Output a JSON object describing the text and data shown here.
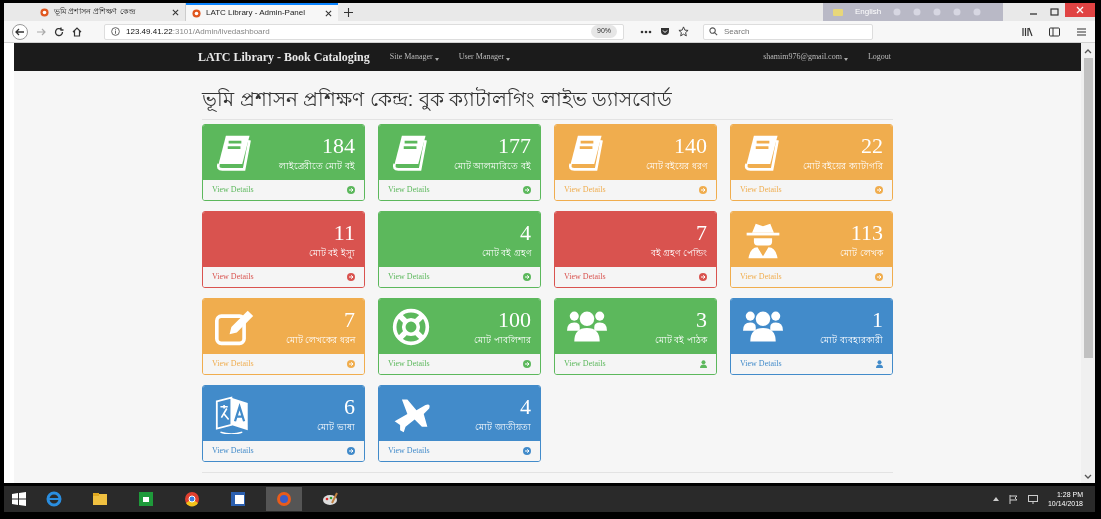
{
  "browser": {
    "tabs": [
      {
        "title": "ভূমি প্রশাসন প্রশিক্ষণ কেন্দ্র",
        "selected": false
      },
      {
        "title": "LATC Library - Admin-Panel",
        "selected": true
      }
    ],
    "url": {
      "host": "123.49.41.22",
      "path": ":3101/Admin/livedashboard"
    },
    "zoom": "90%",
    "search_placeholder": "Search",
    "language": "English"
  },
  "navbar": {
    "brand": "LATC Library - Book Cataloging",
    "menus": [
      {
        "label": "Site Manager",
        "dropdown": true
      },
      {
        "label": "User Manager",
        "dropdown": true
      }
    ],
    "user": {
      "label": "shamim976@gmail.com",
      "dropdown": true
    },
    "logout": "Logout"
  },
  "heading": "ভূমি প্রশাসন প্রশিক্ষণ কেন্দ্র: বুক ক্যাটালগিং লাইভ ড্যাসবোর্ড",
  "cards": [
    {
      "value": "184",
      "label": "লাইব্রেরীতে মোট বই",
      "color": "#5cb85c",
      "kind": "book",
      "footer": {
        "link": "View Details",
        "kind": "arrow"
      }
    },
    {
      "value": "177",
      "label": "মোট আলমারিতে বই",
      "color": "#5cb85c",
      "kind": "book",
      "footer": {
        "link": "View Details",
        "kind": "arrow"
      }
    },
    {
      "value": "140",
      "label": "মোট বইয়ের ধরণ",
      "color": "#f0ad4e",
      "kind": "book",
      "footer": {
        "link": "View Details",
        "kind": "arrow"
      }
    },
    {
      "value": "22",
      "label": "মোট বইয়ের ক্যাটাগরি",
      "color": "#f0ad4e",
      "kind": "book",
      "footer": {
        "link": "View Details",
        "kind": "arrow"
      }
    },
    {
      "value": "11",
      "label": "মোট বই ইস্যু",
      "color": "#d9534f",
      "footer": {
        "link": "View Details",
        "kind": "arrow"
      }
    },
    {
      "value": "4",
      "label": "মোট বই গ্রহণ",
      "color": "#5cb85c",
      "footer": {
        "link": "View Details",
        "kind": "arrow"
      }
    },
    {
      "value": "7",
      "label": "বই গ্রহণ পেন্ডিং",
      "color": "#d9534f",
      "footer": {
        "link": "View Details",
        "kind": "arrow"
      }
    },
    {
      "value": "113",
      "label": "মোট লেখক",
      "color": "#f0ad4e",
      "kind": "spy",
      "footer": {
        "link": "View Details",
        "kind": "arrow"
      }
    },
    {
      "value": "7",
      "label": "মোট লেখকের ধরন",
      "color": "#f0ad4e",
      "kind": "edit",
      "footer": {
        "link": "View Details",
        "kind": "arrow"
      }
    },
    {
      "value": "100",
      "label": "মোট পাবলিশার",
      "color": "#5cb85c",
      "kind": "lifebuoy",
      "footer": {
        "link": "View Details",
        "kind": "arrow"
      }
    },
    {
      "value": "3",
      "label": "মোট বই পাঠক",
      "color": "#5cb85c",
      "kind": "users",
      "footer": {
        "link": "View Details",
        "kind": "user"
      }
    },
    {
      "value": "1",
      "label": "মোট ব্যবহারকারী",
      "color": "#428bca",
      "kind": "users",
      "footer": {
        "link": "View Details",
        "kind": "user"
      }
    },
    {
      "value": "6",
      "label": "মোট ভাষা",
      "color": "#428bca",
      "kind": "translate",
      "footer": {
        "link": "View Details",
        "kind": "arrow"
      }
    },
    {
      "value": "4",
      "label": "মোট জাতীয়তা",
      "color": "#428bca",
      "kind": "plane",
      "footer": {
        "link": "View Details",
        "kind": "arrow"
      }
    }
  ],
  "taskbar": {
    "time": "1:28 PM",
    "date": "10/14/2018"
  }
}
